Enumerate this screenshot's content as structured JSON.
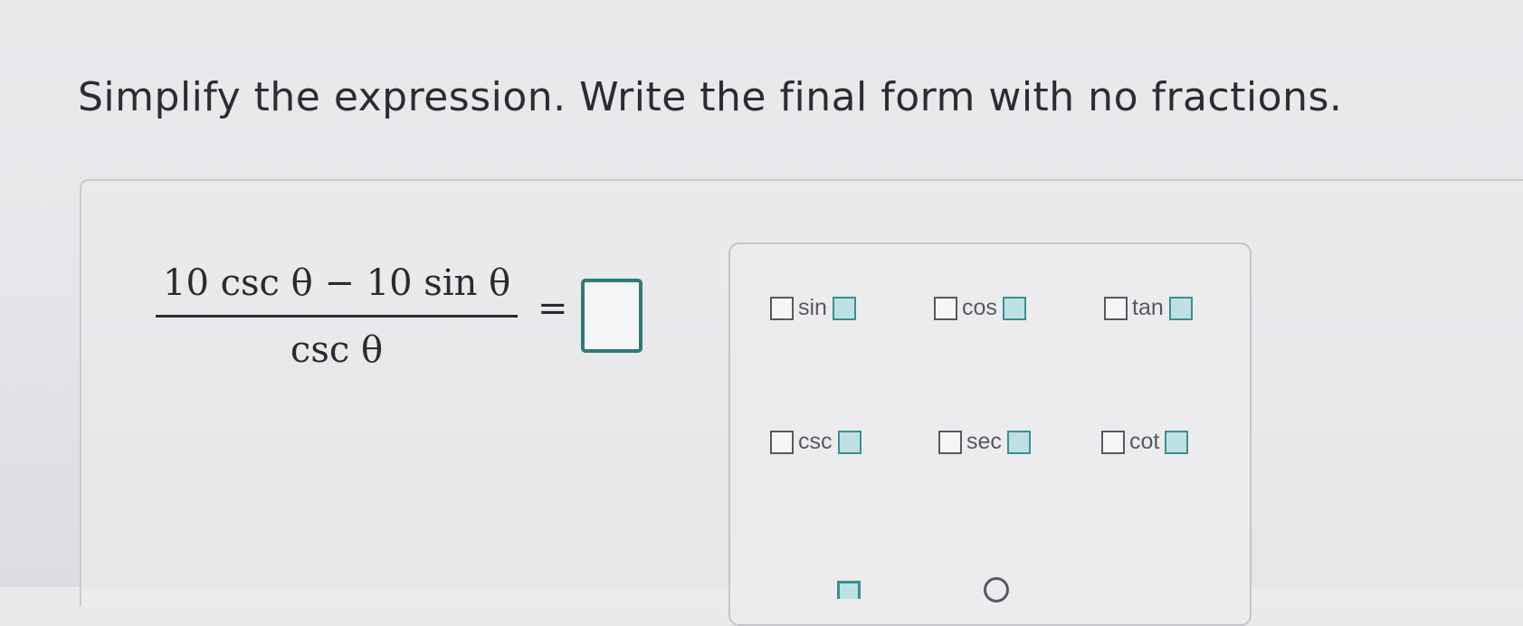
{
  "question": {
    "prompt": "Simplify the expression. Write the final form with no fractions."
  },
  "expression": {
    "numerator": "10 csc θ − 10 sin θ",
    "denominator": "csc θ",
    "equals": "=",
    "answer_value": ""
  },
  "palette": {
    "functions": [
      {
        "label": "sin"
      },
      {
        "label": "cos"
      },
      {
        "label": "tan"
      },
      {
        "label": "csc"
      },
      {
        "label": "sec"
      },
      {
        "label": "cot"
      }
    ]
  },
  "colors": {
    "accent_teal": "#2e7b78",
    "slot_fill": "#bfe0e3",
    "text_dark": "#2b2d31",
    "palette_text": "#555a61"
  }
}
